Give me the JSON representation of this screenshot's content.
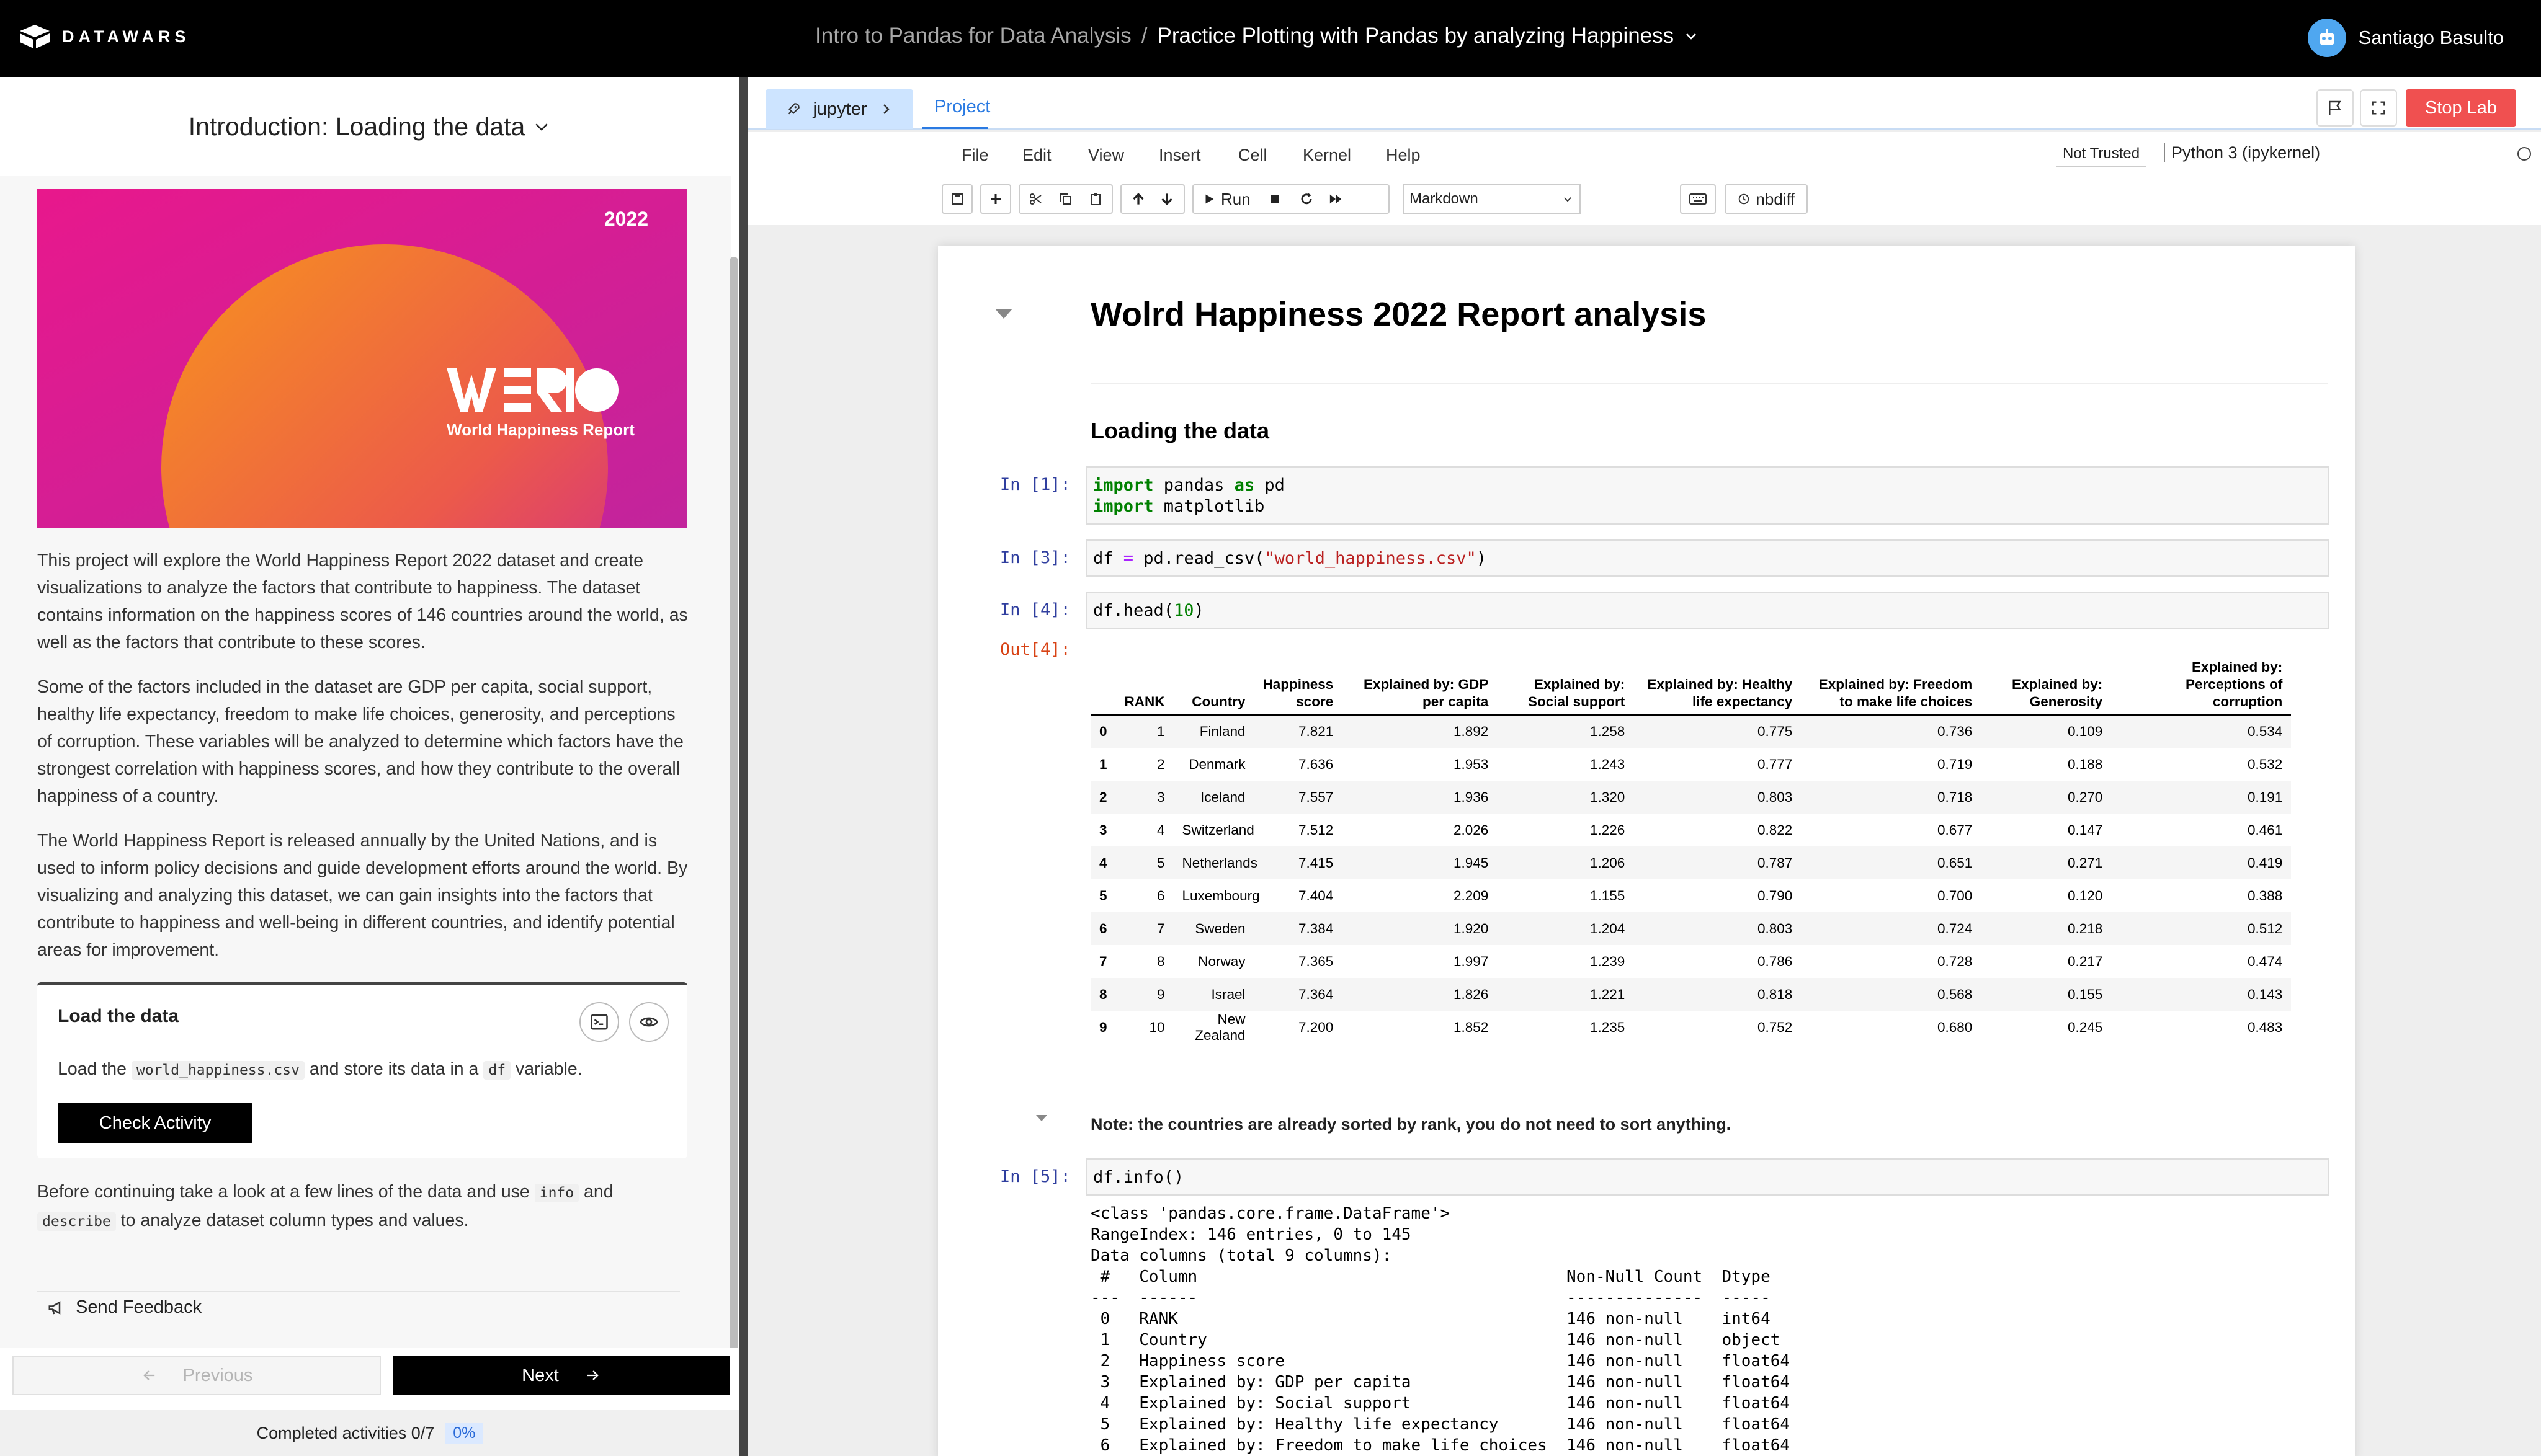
{
  "topbar": {
    "brand": "DATAWARS",
    "course": "Intro to Pandas for Data Analysis",
    "separator": "/",
    "project": "Practice Plotting with Pandas by analyzing Happiness",
    "user_name": "Santiago Basulto"
  },
  "left": {
    "section_title": "Introduction: Loading the data",
    "hero": {
      "year": "2022",
      "logo_text": "World Happiness Report"
    },
    "paragraphs": [
      "This project will explore the World Happiness Report 2022 dataset and create visualizations to analyze the factors that contribute to happiness. The dataset contains information on the happiness scores of 146 countries around the world, as well as the factors that contribute to these scores.",
      "Some of the factors included in the dataset are GDP per capita, social support, healthy life expectancy, freedom to make life choices, generosity, and perceptions of corruption. These variables will be analyzed to determine which factors have the strongest correlation with happiness scores, and how they contribute to the overall happiness of a country.",
      "The World Happiness Report is released annually by the United Nations, and is used to inform policy decisions and guide development efforts around the world. By visualizing and analyzing this dataset, we can gain insights into the factors that contribute to happiness and well-being in different countries, and identify potential areas for improvement."
    ],
    "task": {
      "title": "Load the data",
      "desc_pre": "Load the",
      "desc_code1": "world_happiness.csv",
      "desc_mid": "and store its data in a",
      "desc_code2": "df",
      "desc_post": "variable.",
      "check_label": "Check Activity"
    },
    "after": {
      "pre": "Before continuing take a look at a few lines of the data and use",
      "code1": "info",
      "mid": "and",
      "code2": "describe",
      "post": "to analyze dataset column types and values."
    },
    "feedback_label": "Send Feedback",
    "prev_label": "Previous",
    "next_label": "Next",
    "completed_label": "Completed activities 0/7",
    "completed_pct": "0%"
  },
  "right": {
    "tab_jupyter": "jupyter",
    "tab_project": "Project",
    "stop_label": "Stop Lab",
    "menu": [
      "File",
      "Edit",
      "View",
      "Insert",
      "Cell",
      "Kernel",
      "Help"
    ],
    "not_trusted": "Not Trusted",
    "kernel": "Python 3 (ipykernel)",
    "run_label": "Run",
    "cell_type": "Markdown",
    "nbdiff_label": "nbdiff"
  },
  "notebook": {
    "title": "Wolrd Happiness 2022 Report analysis",
    "subtitle": "Loading the data",
    "cells": [
      {
        "prompt": "In [1]:"
      },
      {
        "prompt": "In [3]:"
      },
      {
        "prompt": "In [4]:",
        "out_prompt": "Out[4]:"
      },
      {
        "prompt": "In [5]:"
      }
    ],
    "table": {
      "headers": [
        "",
        "RANK",
        "Country",
        "Happiness score",
        "Explained by: GDP per capita",
        "Explained by: Social support",
        "Explained by: Healthy life expectancy",
        "Explained by: Freedom to make life choices",
        "Explained by: Generosity",
        "Explained by: Perceptions of corruption"
      ],
      "rows": [
        [
          "0",
          "1",
          "Finland",
          "7.821",
          "1.892",
          "1.258",
          "0.775",
          "0.736",
          "0.109",
          "0.534"
        ],
        [
          "1",
          "2",
          "Denmark",
          "7.636",
          "1.953",
          "1.243",
          "0.777",
          "0.719",
          "0.188",
          "0.532"
        ],
        [
          "2",
          "3",
          "Iceland",
          "7.557",
          "1.936",
          "1.320",
          "0.803",
          "0.718",
          "0.270",
          "0.191"
        ],
        [
          "3",
          "4",
          "Switzerland",
          "7.512",
          "2.026",
          "1.226",
          "0.822",
          "0.677",
          "0.147",
          "0.461"
        ],
        [
          "4",
          "5",
          "Netherlands",
          "7.415",
          "1.945",
          "1.206",
          "0.787",
          "0.651",
          "0.271",
          "0.419"
        ],
        [
          "5",
          "6",
          "Luxembourg",
          "7.404",
          "2.209",
          "1.155",
          "0.790",
          "0.700",
          "0.120",
          "0.388"
        ],
        [
          "6",
          "7",
          "Sweden",
          "7.384",
          "1.920",
          "1.204",
          "0.803",
          "0.724",
          "0.218",
          "0.512"
        ],
        [
          "7",
          "8",
          "Norway",
          "7.365",
          "1.997",
          "1.239",
          "0.786",
          "0.728",
          "0.217",
          "0.474"
        ],
        [
          "8",
          "9",
          "Israel",
          "7.364",
          "1.826",
          "1.221",
          "0.818",
          "0.568",
          "0.155",
          "0.143"
        ],
        [
          "9",
          "10",
          "New Zealand",
          "7.200",
          "1.852",
          "1.235",
          "0.752",
          "0.680",
          "0.245",
          "0.483"
        ]
      ]
    },
    "note": "Note: the countries are already sorted by rank, you do not need to sort anything.",
    "info_output": "<class 'pandas.core.frame.DataFrame'>\nRangeIndex: 146 entries, 0 to 145\nData columns (total 9 columns):\n #   Column                                      Non-Null Count  Dtype  \n---  ------                                      --------------  -----  \n 0   RANK                                        146 non-null    int64  \n 1   Country                                     146 non-null    object \n 2   Happiness score                             146 non-null    float64\n 3   Explained by: GDP per capita                146 non-null    float64\n 4   Explained by: Social support                146 non-null    float64\n 5   Explained by: Healthy life expectancy       146 non-null    float64\n 6   Explained by: Freedom to make life choices  146 non-null    float64"
  }
}
